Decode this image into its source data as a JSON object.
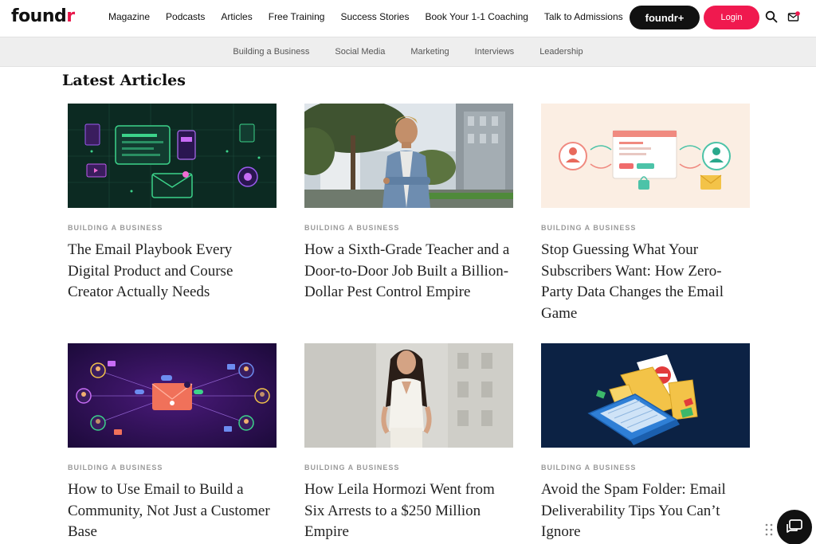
{
  "brand": {
    "logo_main": "found",
    "logo_accent": "r"
  },
  "nav": {
    "items": [
      "Magazine",
      "Podcasts",
      "Articles",
      "Free Training",
      "Success Stories",
      "Book Your 1-1 Coaching",
      "Talk to Admissions"
    ],
    "foundr_plus": "foundr+",
    "login": "Login"
  },
  "categories": [
    "Building a Business",
    "Social Media",
    "Marketing",
    "Interviews",
    "Leadership"
  ],
  "section_title": "Latest Articles",
  "articles": [
    {
      "category": "Building a Business",
      "title": "The Email Playbook Every Digital Product and Course Creator Actually Needs"
    },
    {
      "category": "Building a Business",
      "title": "How a Sixth-Grade Teacher and a Door-to-Door Job Built a Billion-Dollar Pest Control Empire"
    },
    {
      "category": "Building a Business",
      "title": "Stop Guessing What Your Subscribers Want: How Zero-Party Data Changes the Email Game"
    },
    {
      "category": "Building a Business",
      "title": "How to Use Email to Build a Community, Not Just a Customer Base"
    },
    {
      "category": "Building a Business",
      "title": "How Leila Hormozi Went from Six Arrests to a $250 Million Empire"
    },
    {
      "category": "Building a Business",
      "title": "Avoid the Spam Folder: Email Deliverability Tips You Can’t Ignore"
    }
  ],
  "icons": {
    "search": "search-icon",
    "notifications": "mail-notification-icon",
    "chat": "chat-icon"
  },
  "colors": {
    "accent": "#f0194f",
    "dark": "#111111",
    "catbar": "#eeeeee"
  }
}
